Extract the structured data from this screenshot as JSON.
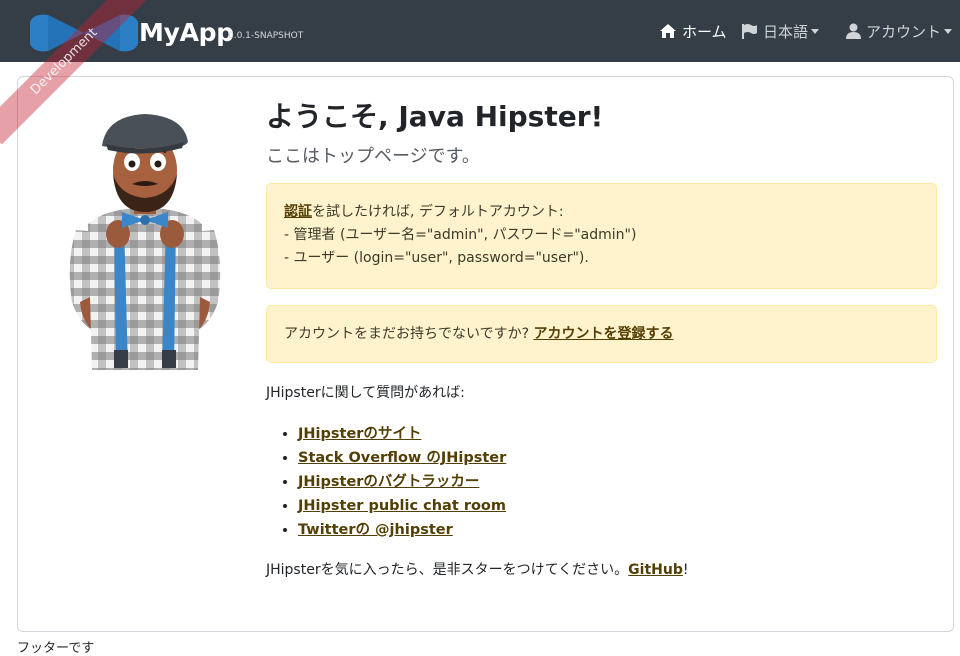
{
  "navbar": {
    "brand_name": "MyApp",
    "version": "0.0.1-SNAPSHOT",
    "ribbon": "Development",
    "items": [
      {
        "label": "ホーム",
        "icon": "home-icon",
        "active": true
      },
      {
        "label": "日本語",
        "icon": "flag-icon",
        "dropdown": true
      },
      {
        "label": "アカウント",
        "icon": "user-icon",
        "dropdown": true
      }
    ]
  },
  "main": {
    "title": "ようこそ, Java Hipster!",
    "lead": "ここはトップページです。",
    "alert1": {
      "link": "認証",
      "text1": "を試したければ, デフォルトアカウント:",
      "line2": "- 管理者 (ユーザー名=\"admin\", パスワード=\"admin\")",
      "line3": "- ユーザー (login=\"user\", password=\"user\")."
    },
    "alert2": {
      "text": "アカウントをまだお持ちでないですか? ",
      "link": "アカウントを登録する"
    },
    "question": "JHipsterに関して質問があれば:",
    "links": [
      "JHipsterのサイト",
      "Stack Overflow のJHipster",
      "JHipsterのバグトラッカー",
      "JHipster public chat room",
      "Twitterの @jhipster"
    ],
    "github": {
      "text": "JHipsterを気に入ったら、是非スターをつけてください。",
      "link": "GitHub",
      "suffix": "!"
    }
  },
  "footer": {
    "text": "フッターです"
  },
  "colors": {
    "navbar_bg": "#353d47",
    "alert_bg": "#fff3cd",
    "link": "#533f03",
    "ribbon": "#c42030"
  }
}
